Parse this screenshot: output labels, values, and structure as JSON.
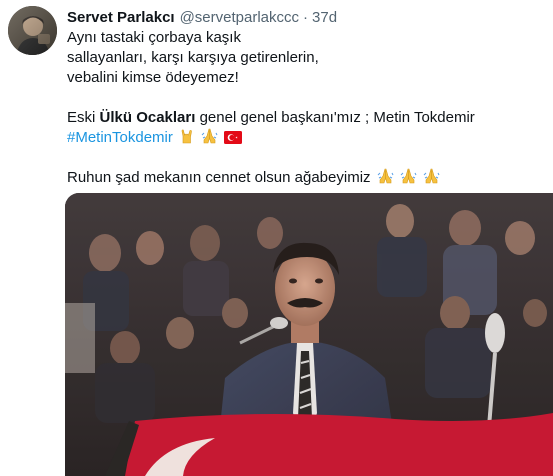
{
  "tweet": {
    "author_name": "Servet Parlakcı",
    "handle": "@servetparlakccc",
    "separator": "·",
    "time": "37d",
    "lines": {
      "l1": "Aynı tastaki çorbaya kaşık",
      "l2": "sallayanları, karşı karşıya getirenlerin,",
      "l3": "vebalini kimse ödeyemez!",
      "l4_prefix": "Eski ",
      "l4_bold": "Ülkü Ocakları",
      "l4_suffix": " genel genel başkanı'mız ; Metin Tokdemir",
      "hashtag": "#MetinTokdemir",
      "l6": "Ruhun şad mekanın cennet olsun ağabeyimiz"
    },
    "emojis": [
      "raised-fist-horns-icon",
      "folded-hands-icon",
      "turkish-flag-icon"
    ],
    "media_alt_subject": "photo-of-speaker-at-microphone"
  },
  "colors": {
    "hashtag": "#1b95e0",
    "secondary_text": "#536471",
    "primary_text": "#0f1419",
    "flag_red": "#e30a17"
  }
}
